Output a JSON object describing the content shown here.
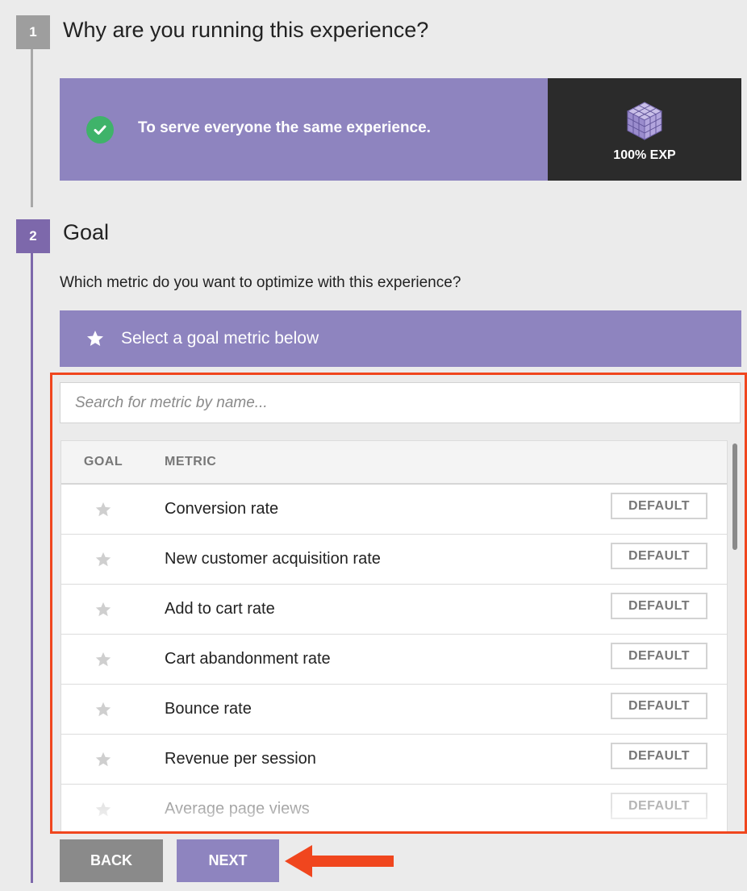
{
  "step1": {
    "number": "1",
    "title": "Why are you running this experience?",
    "experience_label": "To serve everyone the same experience.",
    "experience_type": "100% EXP",
    "check_icon": "check-circle-icon",
    "type_icon": "cube-icon"
  },
  "step2": {
    "number": "2",
    "title": "Goal",
    "question": "Which metric do you want to optimize with this experience?",
    "banner_label": "Select a goal metric below",
    "banner_icon": "star-icon"
  },
  "search": {
    "placeholder": "Search for metric by name..."
  },
  "table": {
    "headers": [
      "GOAL",
      "METRIC"
    ],
    "rows": [
      {
        "label": "Conversion rate",
        "badge": "DEFAULT"
      },
      {
        "label": "New customer acquisition rate",
        "badge": "DEFAULT"
      },
      {
        "label": "Add to cart rate",
        "badge": "DEFAULT"
      },
      {
        "label": "Cart abandonment rate",
        "badge": "DEFAULT"
      },
      {
        "label": "Bounce rate",
        "badge": "DEFAULT"
      },
      {
        "label": "Revenue per session",
        "badge": "DEFAULT"
      },
      {
        "label": "Average page views",
        "badge": "DEFAULT"
      }
    ]
  },
  "buttons": {
    "back": "BACK",
    "next": "NEXT"
  },
  "colors": {
    "accent_purple": "#8e84bf",
    "step_purple": "#7d68ab",
    "highlight_red": "#f0461e",
    "success_green": "#3fb36a",
    "dark_panel": "#2b2b2b"
  }
}
